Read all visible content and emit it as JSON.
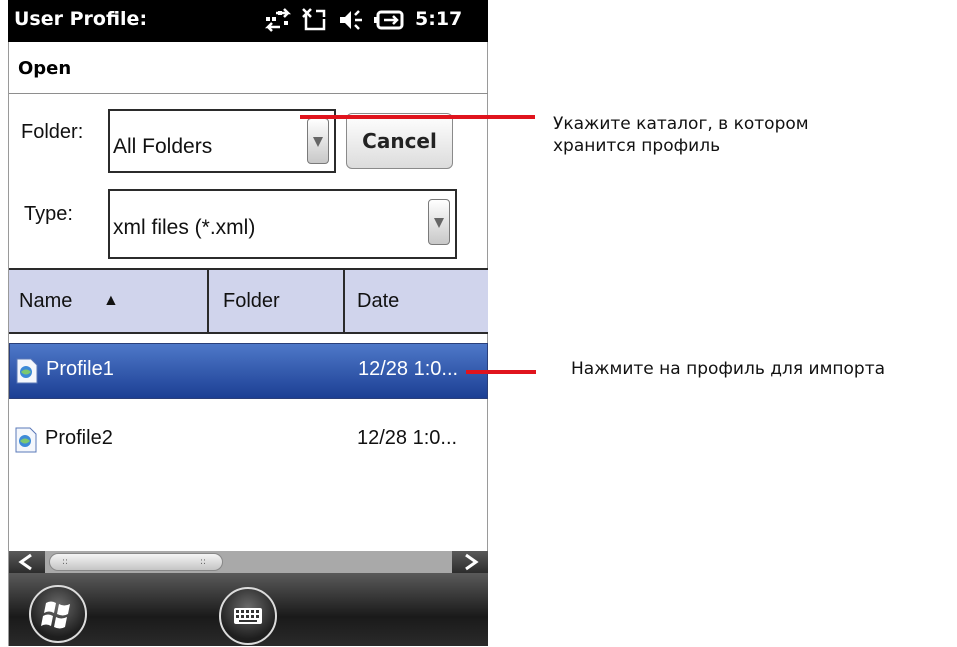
{
  "statusbar": {
    "title": "User Profile:",
    "time": "5:17",
    "icons": [
      "connectivity-icon",
      "sync-icon",
      "speaker-icon",
      "battery-icon"
    ]
  },
  "dialog": {
    "heading": "Open",
    "folder": {
      "label": "Folder:",
      "value": "All Folders"
    },
    "type": {
      "label": "Type:",
      "value": "xml files (*.xml)"
    },
    "cancel_label": "Cancel"
  },
  "list": {
    "columns": [
      "Name",
      "Folder",
      "Date"
    ],
    "sort_indicator": "▲",
    "rows": [
      {
        "name": "Profile1",
        "date": "12/28 1:0...",
        "selected": true
      },
      {
        "name": "Profile2",
        "date": "12/28 1:0...",
        "selected": false
      }
    ]
  },
  "bottombar": {
    "buttons": [
      "windows-start-icon",
      "keyboard-icon"
    ]
  },
  "annotations": {
    "folder_note": "Укажите каталог, в котором\nхранится профиль",
    "profile_note": "Нажмите на профиль для импорта"
  },
  "colors": {
    "accent_selection": "#2a56b4",
    "header_bg": "#d0d4ec",
    "callout": "#e0141d"
  }
}
